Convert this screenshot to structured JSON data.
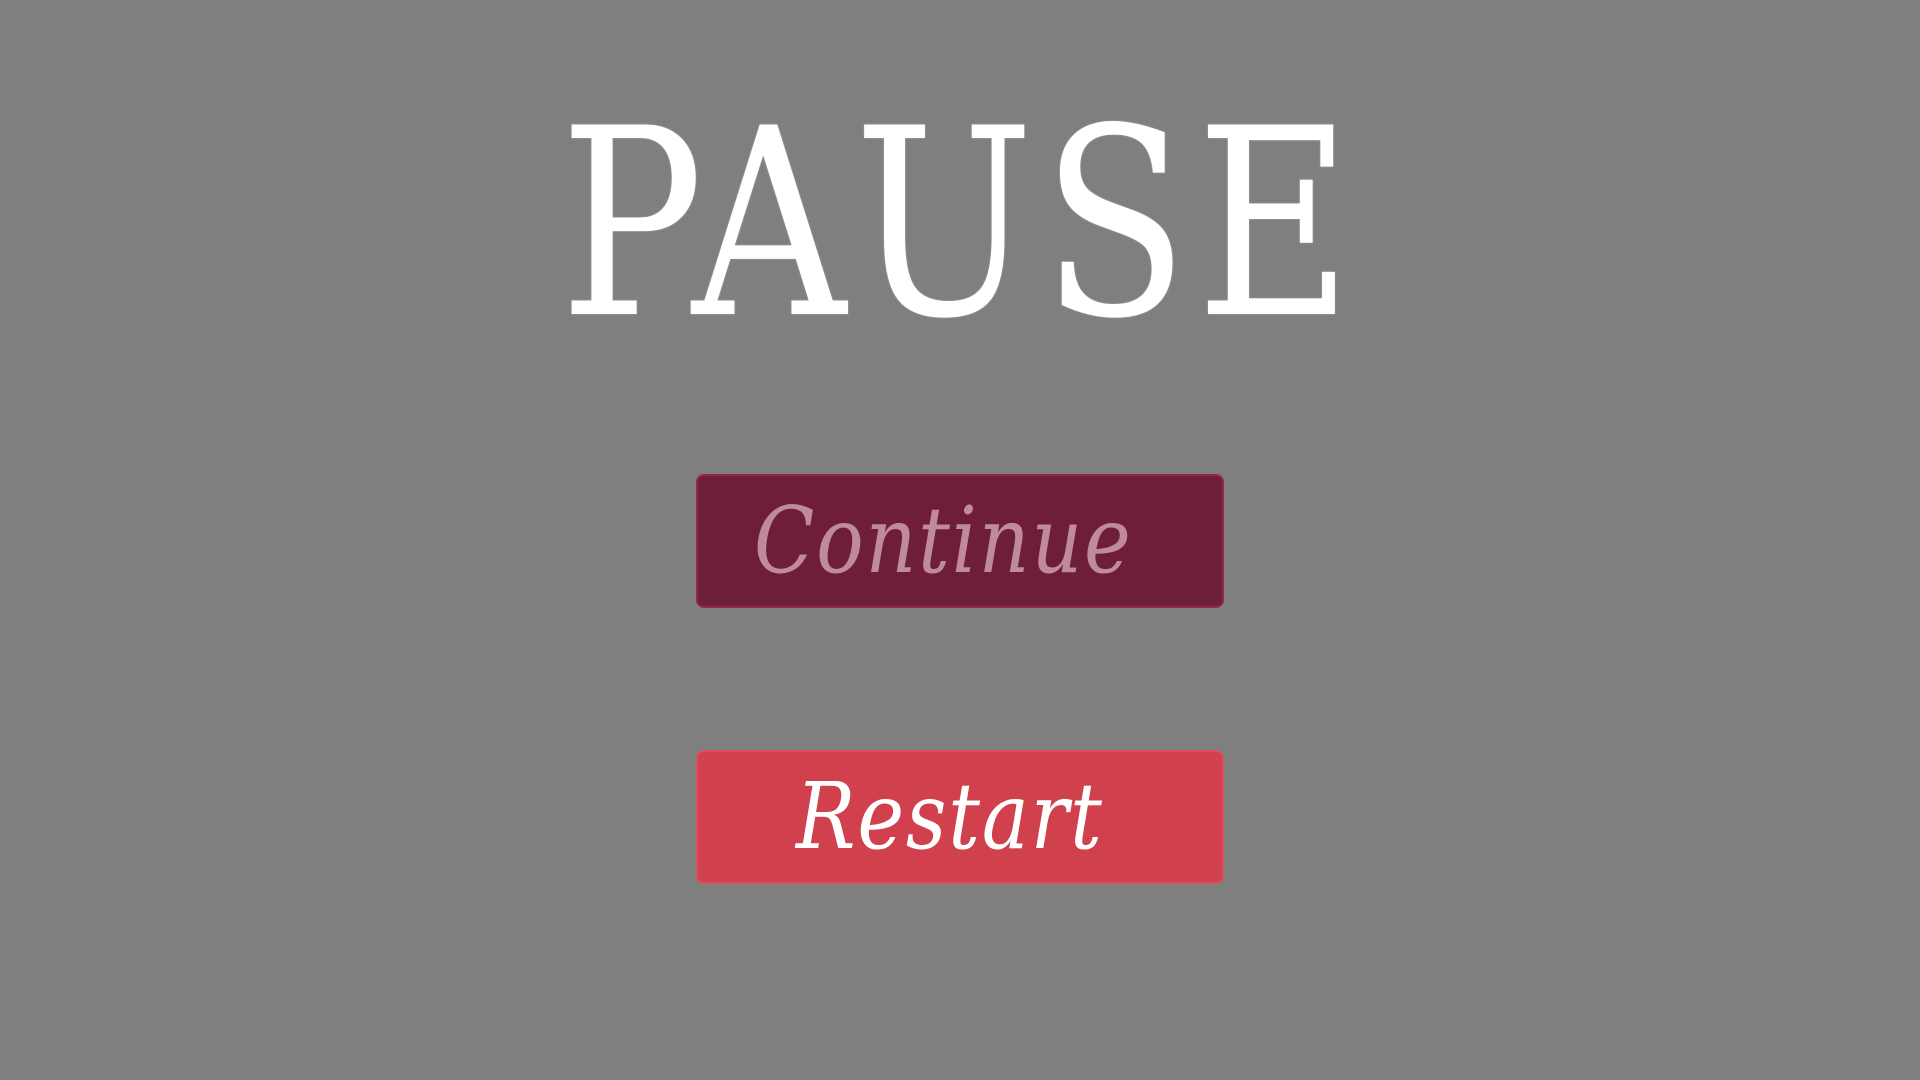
{
  "screen": {
    "title": "PAUSE",
    "background_color": "#7f7f7f",
    "title_color": "#ffffff"
  },
  "buttons": {
    "continue": {
      "label": "Continue",
      "state": "disabled",
      "background_color": "#6e1d3a",
      "text_color": "#bf8a99"
    },
    "restart": {
      "label": "Restart",
      "state": "enabled",
      "background_color": "#d0414d",
      "text_color": "#ffffff"
    }
  }
}
